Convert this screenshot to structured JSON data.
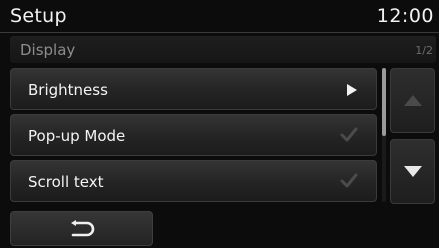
{
  "header": {
    "title": "Setup",
    "clock": "12:00"
  },
  "sub": {
    "title": "Display",
    "page": "1/2"
  },
  "rows": [
    {
      "label": "Brightness",
      "control": "arrow-right"
    },
    {
      "label": "Pop-up Mode",
      "control": "checkbox",
      "checked": true
    },
    {
      "label": "Scroll text",
      "control": "checkbox",
      "checked": true
    }
  ],
  "nav": {
    "up_enabled": false,
    "down_enabled": true,
    "scroll_position": 0
  },
  "footer": {
    "back_icon": "back-arrow-icon"
  },
  "colors": {
    "background": "#0c0c0c",
    "text": "#f4f4f4",
    "dim_text": "#8d8d8d"
  }
}
